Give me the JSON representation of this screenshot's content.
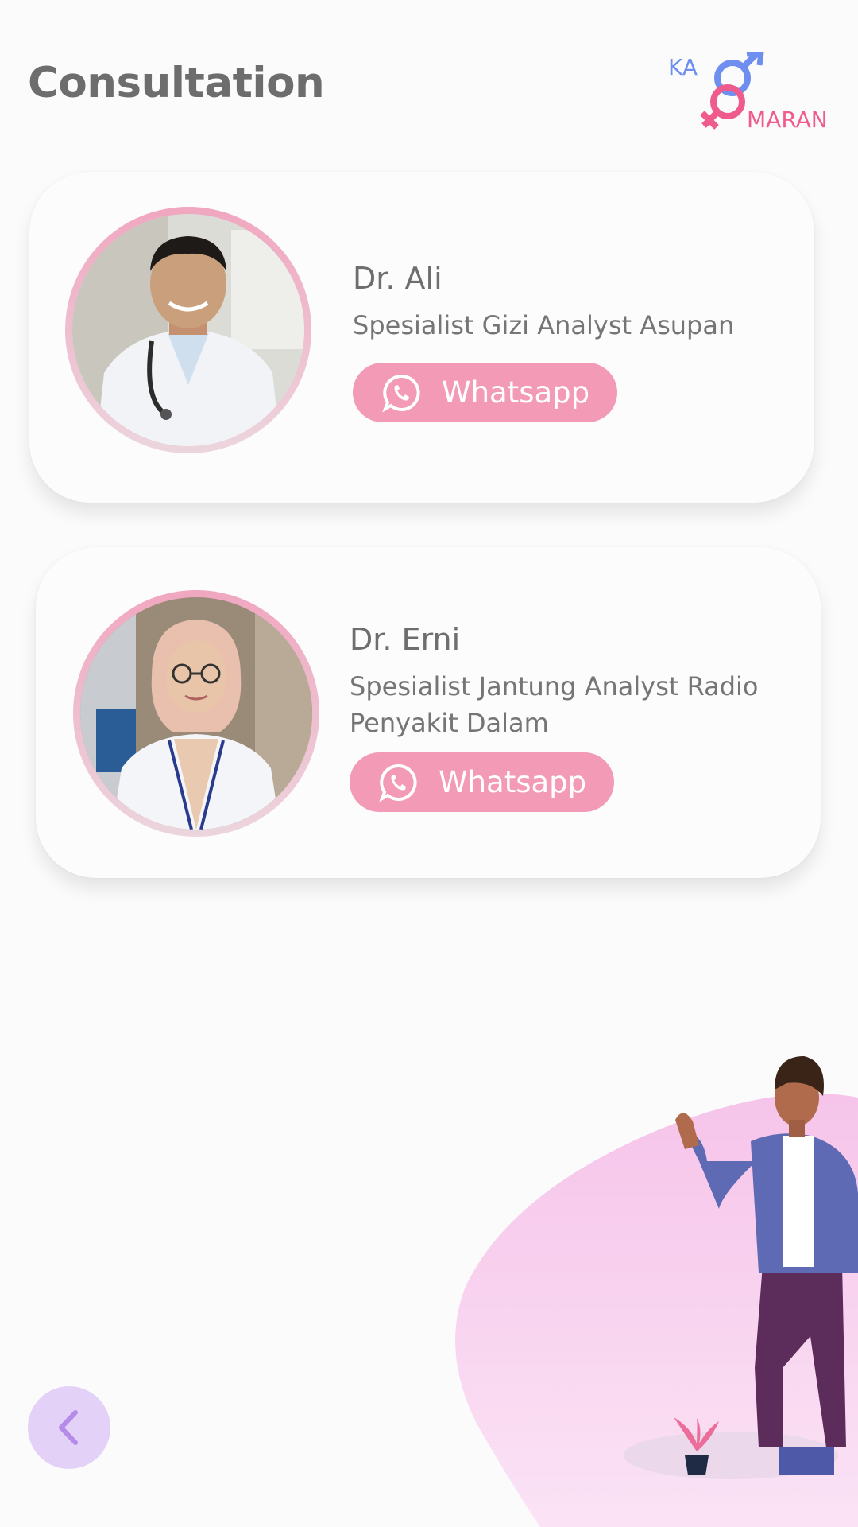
{
  "header": {
    "title": "Consultation",
    "logo": {
      "top_text": "KA",
      "bottom_text": "MARAN",
      "icon": "gender-symbols-icon"
    }
  },
  "doctors": [
    {
      "name": "Dr. Ali",
      "specialty": "Spesialist Gizi Analyst Asupan",
      "button_label": "Whatsapp",
      "button_icon": "whatsapp-icon"
    },
    {
      "name": "Dr. Erni",
      "specialty": "Spesialist Jantung Analyst Radio Penyakit Dalam",
      "button_label": "Whatsapp",
      "button_icon": "whatsapp-icon"
    }
  ],
  "navigation": {
    "back_icon": "chevron-left-icon"
  },
  "colors": {
    "accent_pink": "#f39ab6",
    "logo_blue": "#6f8ff0",
    "logo_pink": "#ee5b8c",
    "back_button_bg": "#e4d1f7"
  }
}
